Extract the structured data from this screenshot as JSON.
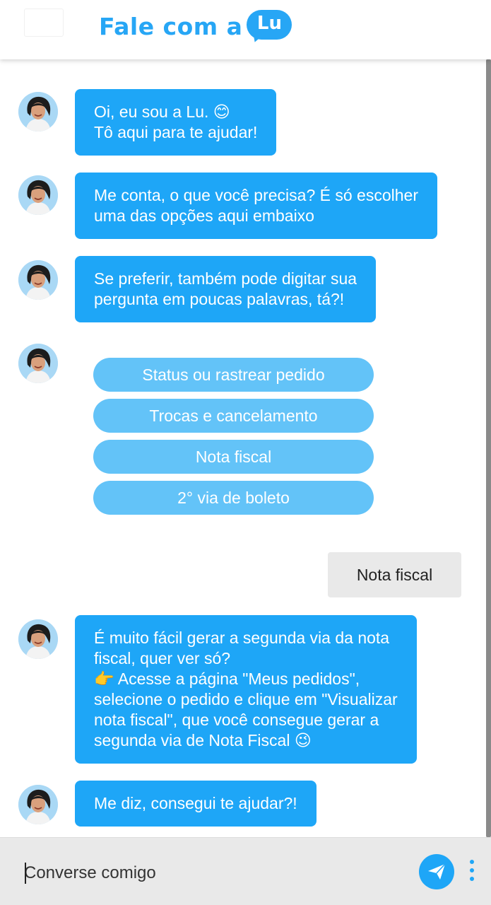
{
  "header": {
    "brand_text": "Fale com a",
    "brand_badge": "Lu",
    "brand_color": "#27a6f5"
  },
  "messages": [
    {
      "from": "bot",
      "text": "Oi, eu sou a Lu. 😊\nTô aqui para te ajudar!"
    },
    {
      "from": "bot",
      "text": "Me conta, o que você precisa? É só escolher\numa das opções aqui embaixo"
    },
    {
      "from": "bot",
      "text": "Se preferir, também pode digitar sua\npergunta em poucas palavras, tá?!"
    },
    {
      "from": "bot",
      "text": "É muito fácil gerar a segunda via da nota\nfiscal, quer ver só?\n👉 Acesse a página \"Meus pedidos\",\nselecione o pedido e clique em \"Visualizar\nnota fiscal\", que você consegue gerar a\nsegunda via de Nota Fiscal 😉"
    },
    {
      "from": "bot",
      "text": "Me diz, consegui te ajudar?!"
    }
  ],
  "options": [
    "Status ou rastrear pedido",
    "Trocas e cancelamento",
    "Nota fiscal",
    "2° via de boleto"
  ],
  "user_message": "Nota fiscal",
  "input": {
    "placeholder": "Converse comigo",
    "value": ""
  },
  "icons": {
    "send": "send-icon",
    "menu": "more-vertical-icon",
    "avatar": "bot-avatar-icon"
  },
  "colors": {
    "bubble": "#1ea6f7",
    "option": "#63c3f8",
    "user_bubble": "#e9e9e9"
  }
}
